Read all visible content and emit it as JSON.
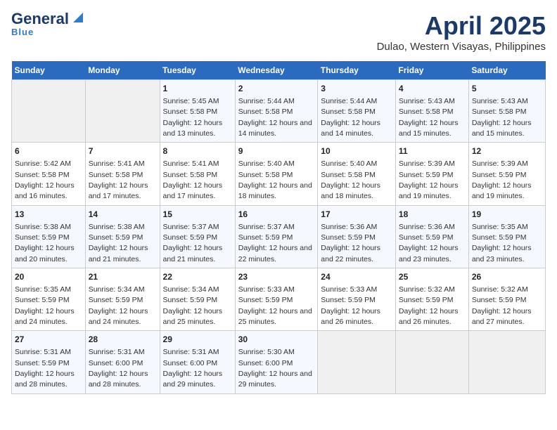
{
  "header": {
    "logo_line1": "General",
    "logo_line2": "Blue",
    "title": "April 2025",
    "subtitle": "Dulao, Western Visayas, Philippines"
  },
  "calendar": {
    "weekdays": [
      "Sunday",
      "Monday",
      "Tuesday",
      "Wednesday",
      "Thursday",
      "Friday",
      "Saturday"
    ],
    "weeks": [
      [
        {
          "day": "",
          "info": ""
        },
        {
          "day": "",
          "info": ""
        },
        {
          "day": "1",
          "info": "Sunrise: 5:45 AM\nSunset: 5:58 PM\nDaylight: 12 hours and 13 minutes."
        },
        {
          "day": "2",
          "info": "Sunrise: 5:44 AM\nSunset: 5:58 PM\nDaylight: 12 hours and 14 minutes."
        },
        {
          "day": "3",
          "info": "Sunrise: 5:44 AM\nSunset: 5:58 PM\nDaylight: 12 hours and 14 minutes."
        },
        {
          "day": "4",
          "info": "Sunrise: 5:43 AM\nSunset: 5:58 PM\nDaylight: 12 hours and 15 minutes."
        },
        {
          "day": "5",
          "info": "Sunrise: 5:43 AM\nSunset: 5:58 PM\nDaylight: 12 hours and 15 minutes."
        }
      ],
      [
        {
          "day": "6",
          "info": "Sunrise: 5:42 AM\nSunset: 5:58 PM\nDaylight: 12 hours and 16 minutes."
        },
        {
          "day": "7",
          "info": "Sunrise: 5:41 AM\nSunset: 5:58 PM\nDaylight: 12 hours and 17 minutes."
        },
        {
          "day": "8",
          "info": "Sunrise: 5:41 AM\nSunset: 5:58 PM\nDaylight: 12 hours and 17 minutes."
        },
        {
          "day": "9",
          "info": "Sunrise: 5:40 AM\nSunset: 5:58 PM\nDaylight: 12 hours and 18 minutes."
        },
        {
          "day": "10",
          "info": "Sunrise: 5:40 AM\nSunset: 5:58 PM\nDaylight: 12 hours and 18 minutes."
        },
        {
          "day": "11",
          "info": "Sunrise: 5:39 AM\nSunset: 5:59 PM\nDaylight: 12 hours and 19 minutes."
        },
        {
          "day": "12",
          "info": "Sunrise: 5:39 AM\nSunset: 5:59 PM\nDaylight: 12 hours and 19 minutes."
        }
      ],
      [
        {
          "day": "13",
          "info": "Sunrise: 5:38 AM\nSunset: 5:59 PM\nDaylight: 12 hours and 20 minutes."
        },
        {
          "day": "14",
          "info": "Sunrise: 5:38 AM\nSunset: 5:59 PM\nDaylight: 12 hours and 21 minutes."
        },
        {
          "day": "15",
          "info": "Sunrise: 5:37 AM\nSunset: 5:59 PM\nDaylight: 12 hours and 21 minutes."
        },
        {
          "day": "16",
          "info": "Sunrise: 5:37 AM\nSunset: 5:59 PM\nDaylight: 12 hours and 22 minutes."
        },
        {
          "day": "17",
          "info": "Sunrise: 5:36 AM\nSunset: 5:59 PM\nDaylight: 12 hours and 22 minutes."
        },
        {
          "day": "18",
          "info": "Sunrise: 5:36 AM\nSunset: 5:59 PM\nDaylight: 12 hours and 23 minutes."
        },
        {
          "day": "19",
          "info": "Sunrise: 5:35 AM\nSunset: 5:59 PM\nDaylight: 12 hours and 23 minutes."
        }
      ],
      [
        {
          "day": "20",
          "info": "Sunrise: 5:35 AM\nSunset: 5:59 PM\nDaylight: 12 hours and 24 minutes."
        },
        {
          "day": "21",
          "info": "Sunrise: 5:34 AM\nSunset: 5:59 PM\nDaylight: 12 hours and 24 minutes."
        },
        {
          "day": "22",
          "info": "Sunrise: 5:34 AM\nSunset: 5:59 PM\nDaylight: 12 hours and 25 minutes."
        },
        {
          "day": "23",
          "info": "Sunrise: 5:33 AM\nSunset: 5:59 PM\nDaylight: 12 hours and 25 minutes."
        },
        {
          "day": "24",
          "info": "Sunrise: 5:33 AM\nSunset: 5:59 PM\nDaylight: 12 hours and 26 minutes."
        },
        {
          "day": "25",
          "info": "Sunrise: 5:32 AM\nSunset: 5:59 PM\nDaylight: 12 hours and 26 minutes."
        },
        {
          "day": "26",
          "info": "Sunrise: 5:32 AM\nSunset: 5:59 PM\nDaylight: 12 hours and 27 minutes."
        }
      ],
      [
        {
          "day": "27",
          "info": "Sunrise: 5:31 AM\nSunset: 5:59 PM\nDaylight: 12 hours and 28 minutes."
        },
        {
          "day": "28",
          "info": "Sunrise: 5:31 AM\nSunset: 6:00 PM\nDaylight: 12 hours and 28 minutes."
        },
        {
          "day": "29",
          "info": "Sunrise: 5:31 AM\nSunset: 6:00 PM\nDaylight: 12 hours and 29 minutes."
        },
        {
          "day": "30",
          "info": "Sunrise: 5:30 AM\nSunset: 6:00 PM\nDaylight: 12 hours and 29 minutes."
        },
        {
          "day": "",
          "info": ""
        },
        {
          "day": "",
          "info": ""
        },
        {
          "day": "",
          "info": ""
        }
      ]
    ]
  }
}
